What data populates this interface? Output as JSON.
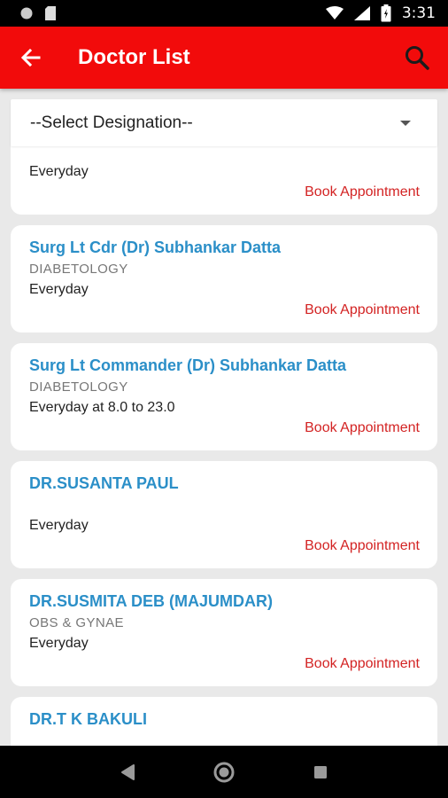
{
  "status_bar": {
    "time": "3:31",
    "icons": [
      "record-icon",
      "sd-card-icon",
      "wifi-icon",
      "signal-icon",
      "battery-icon"
    ]
  },
  "app_bar": {
    "title": "Doctor List",
    "background": "#f20b0b",
    "back_icon": "arrow-left-icon",
    "search_icon": "search-icon"
  },
  "filter": {
    "designation_select": "--Select Designation--"
  },
  "doctors": [
    {
      "name": "",
      "department": "",
      "schedule": "Everyday",
      "action": "Book Appointment"
    },
    {
      "name": "Surg Lt Cdr (Dr) Subhankar Datta",
      "department": "DIABETOLOGY",
      "schedule": "Everyday",
      "action": "Book Appointment"
    },
    {
      "name": "Surg Lt Commander (Dr) Subhankar Datta",
      "department": "DIABETOLOGY",
      "schedule": "Everyday at 8.0 to 23.0",
      "action": "Book Appointment"
    },
    {
      "name": "DR.SUSANTA PAUL",
      "department": "",
      "schedule": "Everyday",
      "action": "Book Appointment"
    },
    {
      "name": "DR.SUSMITA DEB (MAJUMDAR)",
      "department": "OBS & GYNAE",
      "schedule": "Everyday",
      "action": "Book Appointment"
    },
    {
      "name": "DR.T K BAKULI",
      "department": "",
      "schedule": "",
      "action": ""
    }
  ],
  "colors": {
    "accent": "#f20b0b",
    "name_blue": "#2b8fc8",
    "book_red": "#d32323",
    "background": "#e9e9e9"
  },
  "nav_bar": {
    "icons": [
      "back-triangle-icon",
      "home-circle-icon",
      "recents-square-icon"
    ]
  }
}
